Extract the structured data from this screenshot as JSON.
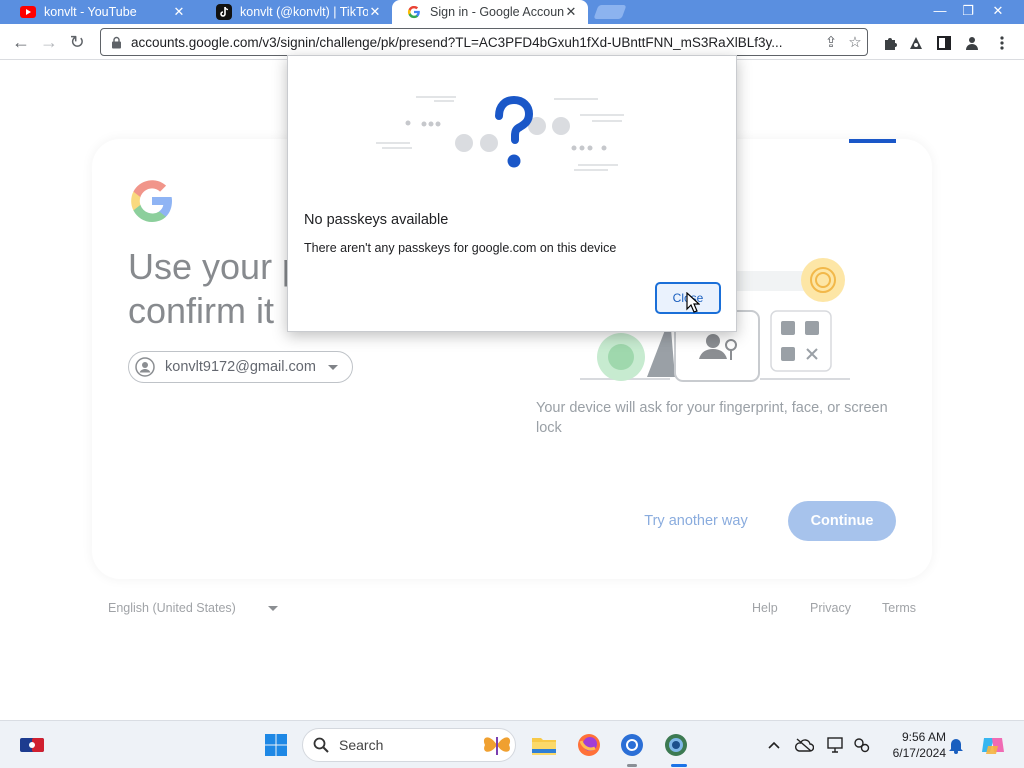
{
  "browser": {
    "tabs": [
      {
        "title": "konvlt - YouTube",
        "favicon": "youtube-icon"
      },
      {
        "title": "konvlt (@konvlt) | TikTok",
        "favicon": "tiktok-icon"
      },
      {
        "title": "Sign in - Google Accounts",
        "favicon": "google-icon"
      }
    ],
    "url": "accounts.google.com/v3/signin/challenge/pk/presend?TL=AC3PFD4bGxuh1fXd-UBnttFNN_mS3RaXlBLf3y..."
  },
  "signin": {
    "heading_line1": "Use your p",
    "heading_line2": "confirm it",
    "email": "konvlt9172@gmail.com",
    "description": "Your device will ask for your fingerprint, face, or screen lock",
    "try_another": "Try another way",
    "continue": "Continue"
  },
  "footer": {
    "language": "English (United States)",
    "help": "Help",
    "privacy": "Privacy",
    "terms": "Terms"
  },
  "dialog": {
    "title": "No passkeys available",
    "text": "There aren't any passkeys for google.com on this device",
    "close": "Close"
  },
  "taskbar": {
    "search_label": "Search",
    "time": "9:56 AM",
    "date": "6/17/2024"
  },
  "colors": {
    "tabstrip": "#5a8fe0",
    "accent_blue": "#1a73e8",
    "continue_bg": "#a7c3ec"
  }
}
